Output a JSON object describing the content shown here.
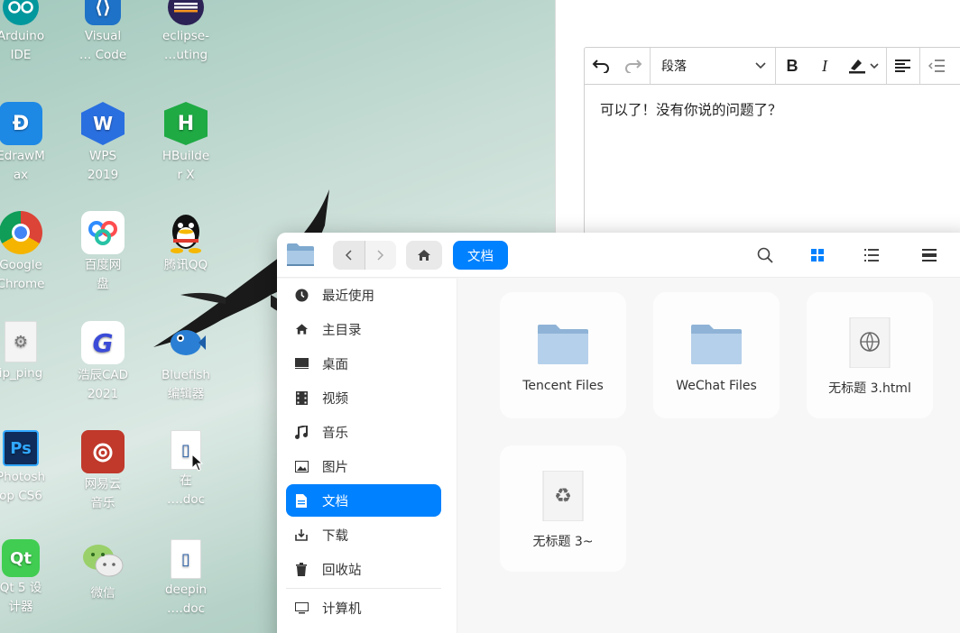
{
  "desktop": {
    "icons": [
      {
        "label": "Arduino\nIDE",
        "icon": "arduino-icon",
        "color": "#00979d"
      },
      {
        "label": "Visual\n… Code",
        "icon": "vscode-icon",
        "color": "#1e72c7"
      },
      {
        "label": "eclipse-\n…uting",
        "icon": "eclipse-icon",
        "color": "#2c2255"
      },
      {
        "label": "EdrawM\nax",
        "icon": "edrawmax-icon",
        "color": "#1e88e5"
      },
      {
        "label": "WPS\n2019",
        "icon": "wps-icon",
        "color": "#2a6fe0"
      },
      {
        "label": "HBuilde\nr X",
        "icon": "hbuilder-icon",
        "color": "#1faa44"
      },
      {
        "label": "Google\nChrome",
        "icon": "chrome-icon",
        "color": "#db4437"
      },
      {
        "label": "百度网\n盘",
        "icon": "baidu-netdisk-icon",
        "color": "#2f8cff"
      },
      {
        "label": "腾讯QQ",
        "icon": "qq-icon",
        "color": "#111111"
      },
      {
        "label": "ip_ping",
        "icon": "settings-doc-icon",
        "color": "#f2f2f2"
      },
      {
        "label": "浩辰CAD\n2021",
        "icon": "gstarcad-icon",
        "color": "#3b4bd8"
      },
      {
        "label": "Bluefish\n编辑器",
        "icon": "bluefish-icon",
        "color": "#2a7fd4"
      },
      {
        "label": "Photosh\nop CS6",
        "icon": "photoshop-icon",
        "color": "#0f2c5a"
      },
      {
        "label": "网易云\n音乐",
        "icon": "netease-music-icon",
        "color": "#c0392b"
      },
      {
        "label": "在\n….doc",
        "icon": "doc-file-icon",
        "color": "#ffffff"
      },
      {
        "label": "Qt 5 设\n计器",
        "icon": "qt-designer-icon",
        "color": "#41cd52"
      },
      {
        "label": "微信",
        "icon": "wechat-icon",
        "color": "#9ad06a"
      },
      {
        "label": "deepin\n….doc",
        "icon": "doc-file-icon",
        "color": "#ffffff"
      }
    ]
  },
  "editor": {
    "block_format": "段落",
    "content": "可以了！没有你说的问题了？"
  },
  "file_manager": {
    "breadcrumb": "文档",
    "accent": "#0081ff",
    "sidebar": [
      {
        "label": "最近使用",
        "icon": "recent-icon"
      },
      {
        "label": "主目录",
        "icon": "home-icon"
      },
      {
        "label": "桌面",
        "icon": "desktop-icon"
      },
      {
        "label": "视频",
        "icon": "video-icon"
      },
      {
        "label": "音乐",
        "icon": "music-icon"
      },
      {
        "label": "图片",
        "icon": "picture-icon"
      },
      {
        "label": "文档",
        "icon": "document-icon",
        "active": true
      },
      {
        "label": "下载",
        "icon": "download-icon"
      },
      {
        "label": "回收站",
        "icon": "trash-icon"
      },
      {
        "label": "计算机",
        "icon": "computer-icon"
      }
    ],
    "items": [
      {
        "name": "Tencent Files",
        "type": "folder"
      },
      {
        "name": "WeChat Files",
        "type": "folder"
      },
      {
        "name": "无标题 3.html",
        "type": "html-file"
      },
      {
        "name": "无标题 3~",
        "type": "backup-file"
      }
    ]
  }
}
